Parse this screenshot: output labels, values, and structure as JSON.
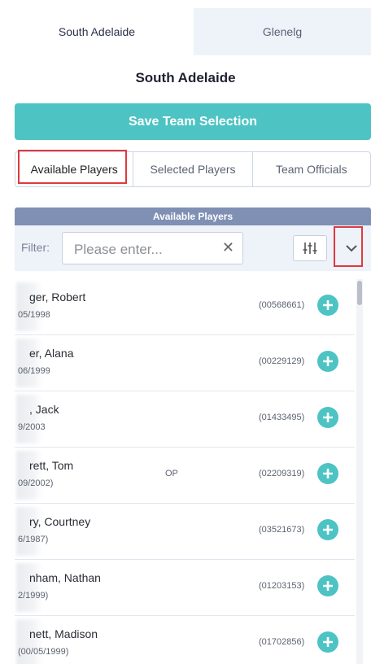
{
  "team_tabs": [
    {
      "label": "South Adelaide",
      "active": true
    },
    {
      "label": "Glenelg",
      "active": false
    }
  ],
  "team_title": "South Adelaide",
  "save_button": "Save Team Selection",
  "sub_tabs": [
    "Available Players",
    "Selected Players",
    "Team Officials"
  ],
  "panel": {
    "header": "Available Players",
    "filter_label": "Filter:",
    "filter_placeholder": "Please enter...",
    "clear_icon": "close-icon",
    "sort_icon": "sliders-icon",
    "expand_icon": "chevron-down-icon"
  },
  "players": [
    {
      "name": "ger, Robert",
      "dob": "05/1998",
      "position": "",
      "id": "(00568661)"
    },
    {
      "name": "er, Alana",
      "dob": "06/1999",
      "position": "",
      "id": "(00229129)"
    },
    {
      "name": ", Jack",
      "dob": "9/2003",
      "position": "",
      "id": "(01433495)"
    },
    {
      "name": "rett, Tom",
      "dob": "09/2002)",
      "position": "OP",
      "id": "(02209319)"
    },
    {
      "name": "ry, Courtney",
      "dob": "6/1987)",
      "position": "",
      "id": "(03521673)"
    },
    {
      "name": "nham, Nathan",
      "dob": "2/1999)",
      "position": "",
      "id": "(01203153)"
    },
    {
      "name": "nett, Madison",
      "dob": "(00/05/1999)",
      "position": "",
      "id": "(01702856)"
    }
  ],
  "colors": {
    "accent": "#4dc3c3",
    "panel_header": "#7f90b4",
    "highlight": "#e0393e"
  }
}
